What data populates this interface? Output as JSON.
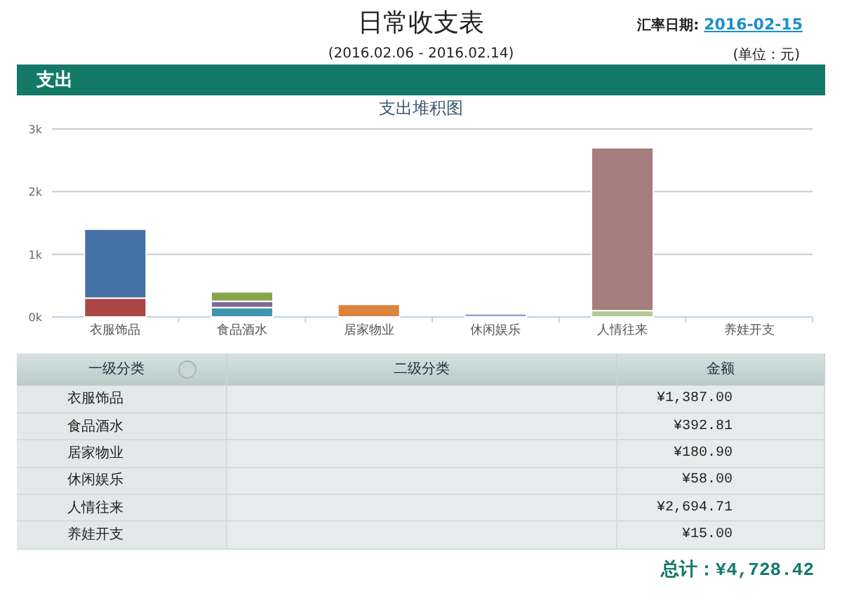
{
  "header": {
    "title": "日常收支表",
    "rate_label": "汇率日期:",
    "rate_date": "2016-02-15",
    "period": "(2016.02.06 - 2016.02.14)",
    "unit": "(单位：元)"
  },
  "section": {
    "title": "支出"
  },
  "chart": {
    "chart_data": {
      "type": "bar",
      "stacked": true,
      "title": "支出堆积图",
      "categories": [
        "衣服饰品",
        "食品酒水",
        "居家物业",
        "休闲娱乐",
        "人情往来",
        "养娃开支"
      ],
      "ylim": [
        0,
        3000
      ],
      "yticks": [
        {
          "value": 0,
          "label": "0k"
        },
        {
          "value": 1000,
          "label": "1k"
        },
        {
          "value": 2000,
          "label": "2k"
        },
        {
          "value": 3000,
          "label": "3k"
        }
      ],
      "series": [
        {
          "color": "#aa4643",
          "values": [
            300,
            null,
            null,
            null,
            null,
            null
          ]
        },
        {
          "color": "#4572a7",
          "values": [
            1100,
            null,
            null,
            null,
            null,
            null
          ]
        },
        {
          "color": "#3d96ae",
          "values": [
            null,
            150,
            null,
            null,
            null,
            null
          ]
        },
        {
          "color": "#80699b",
          "values": [
            null,
            100,
            null,
            null,
            null,
            null
          ]
        },
        {
          "color": "#89a54e",
          "values": [
            null,
            150,
            null,
            null,
            null,
            null
          ]
        },
        {
          "color": "#db843d",
          "values": [
            null,
            null,
            200,
            null,
            null,
            0
          ]
        },
        {
          "color": "#92a8cd",
          "values": [
            null,
            null,
            null,
            50,
            null,
            null
          ]
        },
        {
          "color": "#b5ca92",
          "values": [
            null,
            null,
            null,
            null,
            100,
            null
          ]
        },
        {
          "color": "#a47d7c",
          "values": [
            null,
            null,
            null,
            null,
            2600,
            null
          ]
        }
      ]
    }
  },
  "table": {
    "columns": [
      "一级分类",
      "二级分类",
      "金额"
    ],
    "rows": [
      {
        "category": "衣服饰品",
        "amount": "¥1,387.00"
      },
      {
        "category": "食品酒水",
        "amount": "¥392.81"
      },
      {
        "category": "居家物业",
        "amount": "¥180.90"
      },
      {
        "category": "休闲娱乐",
        "amount": "¥58.00"
      },
      {
        "category": "人情往来",
        "amount": "¥2,694.71"
      },
      {
        "category": "养娃开支",
        "amount": "¥15.00"
      }
    ]
  },
  "total": "总计：¥4,728.42"
}
